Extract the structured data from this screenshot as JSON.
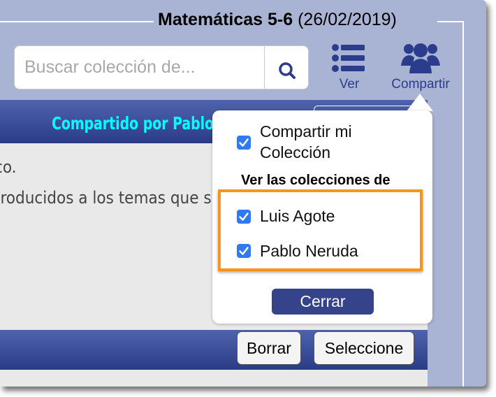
{
  "header": {
    "title_bold": "Matemáticas 5-6",
    "title_date": "(26/02/2019)"
  },
  "search": {
    "placeholder": "Buscar colección de...",
    "icon": "search-icon"
  },
  "toolbar": {
    "ver_label": "Ver",
    "ver_icon": "list-icon",
    "compartir_label": "Compartir",
    "compartir_icon": "users-icon"
  },
  "panel": {
    "header_text": "Compartido por Pablo Neruda",
    "lines": [
      "co.",
      "troducidos a los temas que s"
    ],
    "footer_buttons": {
      "borrar": "Borrar",
      "seleccione": "Seleccione"
    }
  },
  "share_popover": {
    "share_my_collection": [
      "Compartir mi",
      "Colección"
    ],
    "share_my_collection_checked": true,
    "section_title": "Ver las colecciones de",
    "collections": [
      {
        "name": "Luis Agote",
        "checked": true
      },
      {
        "name": "Pablo Neruda",
        "checked": true
      }
    ],
    "close_label": "Cerrar"
  },
  "colors": {
    "frame_bg": "#a9b3d3",
    "header_gradient_top": "#4f63ad",
    "header_gradient_bottom": "#2b3c87",
    "accent_text": "#00ffff",
    "checkbox": "#2f7af0",
    "highlight": "#f7941d",
    "close_button": "#34438a",
    "toolbar_icon": "#2c3c8c"
  }
}
